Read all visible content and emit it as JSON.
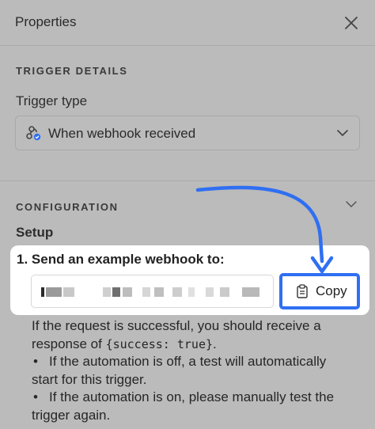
{
  "header": {
    "title": "Properties"
  },
  "trigger_section": {
    "heading": "TRIGGER DETAILS",
    "trigger_type_label": "Trigger type",
    "trigger_type_value": "When webhook received"
  },
  "configuration_section": {
    "heading": "CONFIGURATION",
    "setup_label": "Setup",
    "step_label": "1. Send an example webhook to:",
    "copy_label": "Copy",
    "info_line_1": "If the request is successful, you should receive a",
    "info_line_2_prefix": "response of ",
    "info_line_2_code": "{success: true}",
    "info_line_2_suffix": ".",
    "bullet_1_line_1": "If the automation is off, a test will automatically",
    "bullet_1_line_2": "start for this trigger.",
    "bullet_2_line_1": "If the automation is on, please manually test the",
    "bullet_2_line_2": "trigger again."
  },
  "colors": {
    "overlay_background": "#bbbbbb",
    "accent_blue": "#2f6ff2",
    "card_background": "#ffffff"
  },
  "icons": {
    "close": "close-icon",
    "webhook": "webhook-icon",
    "dropdown": "chevron-down-icon",
    "clipboard": "clipboard-icon",
    "annotation": "curved-arrow-icon"
  }
}
